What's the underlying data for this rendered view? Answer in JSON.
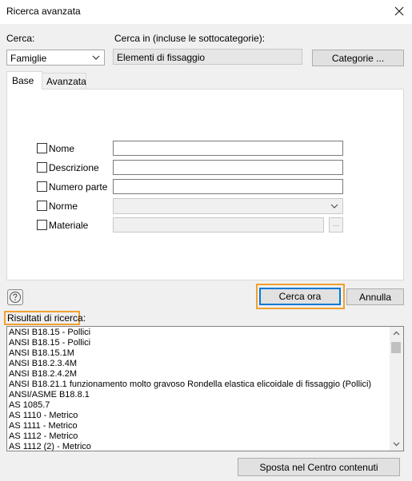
{
  "window": {
    "title": "Ricerca avanzata"
  },
  "search_in": {
    "label": "Cerca:",
    "selected": "Famiglie",
    "category_label": "Cerca in (incluse le sottocategorie):",
    "category_value": "Elementi di fissaggio",
    "categories_button": "Categorie ..."
  },
  "tabs": [
    {
      "label": "Base",
      "active": true
    },
    {
      "label": "Avanzata",
      "active": false
    }
  ],
  "fields": [
    {
      "label": "Nome",
      "value": "",
      "type": "text"
    },
    {
      "label": "Descrizione",
      "value": "",
      "type": "text"
    },
    {
      "label": "Numero parte",
      "value": "",
      "type": "text"
    },
    {
      "label": "Norme",
      "value": "",
      "type": "select"
    },
    {
      "label": "Materiale",
      "value": "",
      "type": "browse",
      "browse_label": "..."
    }
  ],
  "actions": {
    "search_now": "Cerca ora",
    "cancel": "Annulla"
  },
  "results": {
    "label": "Risultati di ricerca:",
    "items": [
      "ANSI B18.15 - Pollici",
      "ANSI B18.15 - Pollici",
      "ANSI B18.15.1M",
      "ANSI B18.2.3.4M",
      "ANSI B18.2.4.2M",
      "ANSI B18.21.1 funzionamento molto gravoso Rondella elastica elicoidale di fissaggio (Pollici)",
      "ANSI/ASME B18.8.1",
      "AS 1085.7",
      "AS 1110 - Metrico",
      "AS 1111 - Metrico",
      "AS 1112 - Metrico",
      "AS 1112 (2) - Metrico"
    ]
  },
  "footer": {
    "move_button": "Sposta nel Centro contenuti"
  },
  "colors": {
    "highlight": "#f0a030",
    "primary_border": "#0078d7"
  }
}
